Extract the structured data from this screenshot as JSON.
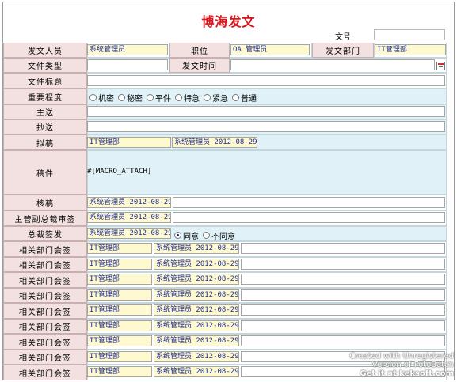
{
  "form": {
    "title": "博海发文",
    "doc_no_label": "文号",
    "doc_no_value": ""
  },
  "header": {
    "author_label": "发文人员",
    "author_value": "系统管理员",
    "position_label": "职位",
    "position_value": "OA 管理员",
    "dept_label": "发文部门",
    "dept_value": "IT管理部",
    "type_label": "文件类型",
    "time_label": "发文时间",
    "subject_label": "文件标题"
  },
  "importance": {
    "label": "重要程度",
    "options": [
      "机密",
      "秘密",
      "平件",
      "特急",
      "紧急",
      "普通"
    ]
  },
  "main_send_label": "主送",
  "copy_send_label": "抄送",
  "draft": {
    "label": "拟稿",
    "dept": "IT管理部",
    "signer": "系统管理员 2012-08-29"
  },
  "body": {
    "label": "稿件",
    "macro": "#[MACRO_ATTACH]"
  },
  "verify": {
    "label": "核稿",
    "signer": "系统管理员 2012-08-29"
  },
  "vp_review": {
    "label": "主管副总裁审签",
    "signer": "系统管理员 2012-08-29"
  },
  "president": {
    "label": "总裁签发",
    "signer": "系统管理员 2012-08-29",
    "agree": "同意",
    "disagree": "不同意"
  },
  "countersign": {
    "label": "相关部门会签",
    "rows": [
      {
        "dept": "IT管理部",
        "signer": "系统管理员 2012-08-29"
      },
      {
        "dept": "IT管理部",
        "signer": "系统管理员 2012-08-29"
      },
      {
        "dept": "IT管理部",
        "signer": "系统管理员 2012-08-29"
      },
      {
        "dept": "IT管理部",
        "signer": "系统管理员 2012-08-29"
      },
      {
        "dept": "IT管理部",
        "signer": "系统管理员 2012-08-29"
      },
      {
        "dept": "IT管理部",
        "signer": "系统管理员 2012-08-29"
      },
      {
        "dept": "IT管理部",
        "signer": "系统管理员 2012-08-29"
      },
      {
        "dept": "IT管理部",
        "signer": "系统管理员 2012-08-29"
      },
      {
        "dept": "IT管理部",
        "signer": "系统管理员 2012-08-29"
      }
    ]
  },
  "watermark": {
    "line1": "Created with Unregistered",
    "line2": "Version of FotoBatch",
    "line3": "Get it at keksoft.com"
  },
  "icons": {
    "calendar": "calendar-icon"
  }
}
